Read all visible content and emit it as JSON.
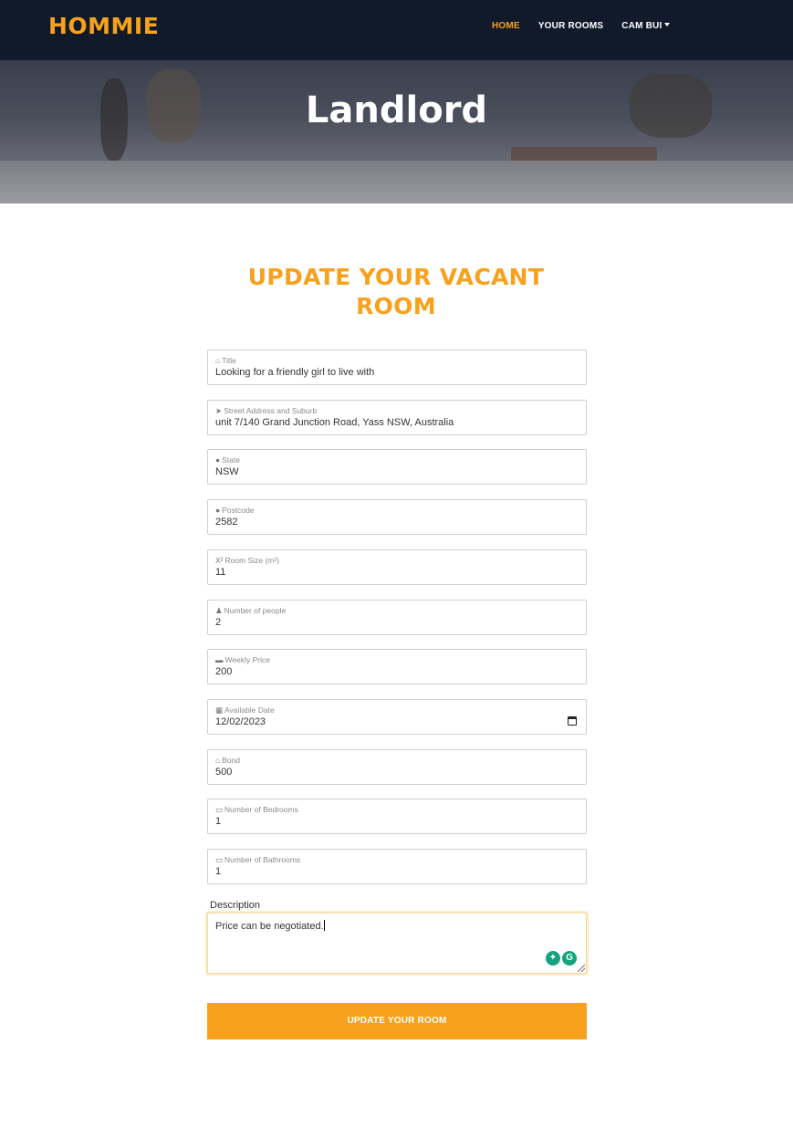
{
  "brand": "HOMMIE",
  "nav": {
    "home": "HOME",
    "your_rooms": "YOUR ROOMS",
    "user": "CAM BUI"
  },
  "hero": {
    "title": "Landlord"
  },
  "form": {
    "heading": "UPDATE YOUR VACANT ROOM",
    "fields": [
      {
        "icon": "home-icon",
        "glyph": "⌂",
        "label": "Title",
        "value": "Looking for a friendly girl to live with"
      },
      {
        "icon": "location-arrow-icon",
        "glyph": "➤",
        "label": "Street Address and Suburb",
        "value": "unit 7/140 Grand Junction Road, Yass NSW, Australia"
      },
      {
        "icon": "map-marker-icon",
        "glyph": "●",
        "label": "State",
        "value": "NSW"
      },
      {
        "icon": "map-pin-icon",
        "glyph": "●",
        "label": "Postcode",
        "value": "2582"
      },
      {
        "icon": "superscript-icon",
        "glyph": "X²",
        "label": "Room Size (m²)",
        "value": "11"
      },
      {
        "icon": "person-icon",
        "glyph": "♟",
        "label": "Number of people",
        "value": "2"
      },
      {
        "icon": "credit-card-icon",
        "glyph": "▬",
        "label": "Weekly Price",
        "value": "200"
      },
      {
        "icon": "calendar-icon",
        "glyph": "▦",
        "label": "Available Date",
        "value": "12/02/2023"
      },
      {
        "icon": "bank-icon",
        "glyph": "⌂",
        "label": "Bond",
        "value": "500"
      },
      {
        "icon": "bed-icon",
        "glyph": "▭",
        "label": "Number of Bedrooms",
        "value": "1"
      },
      {
        "icon": "bath-icon",
        "glyph": "▭",
        "label": "Number of Bathrooms",
        "value": "1"
      }
    ],
    "description_label": "Description",
    "description_value": "Price can be negotiated.",
    "submit_label": "UPDATE YOUR ROOM"
  },
  "colors": {
    "accent": "#f8a11c",
    "navbar": "#111a2b"
  }
}
